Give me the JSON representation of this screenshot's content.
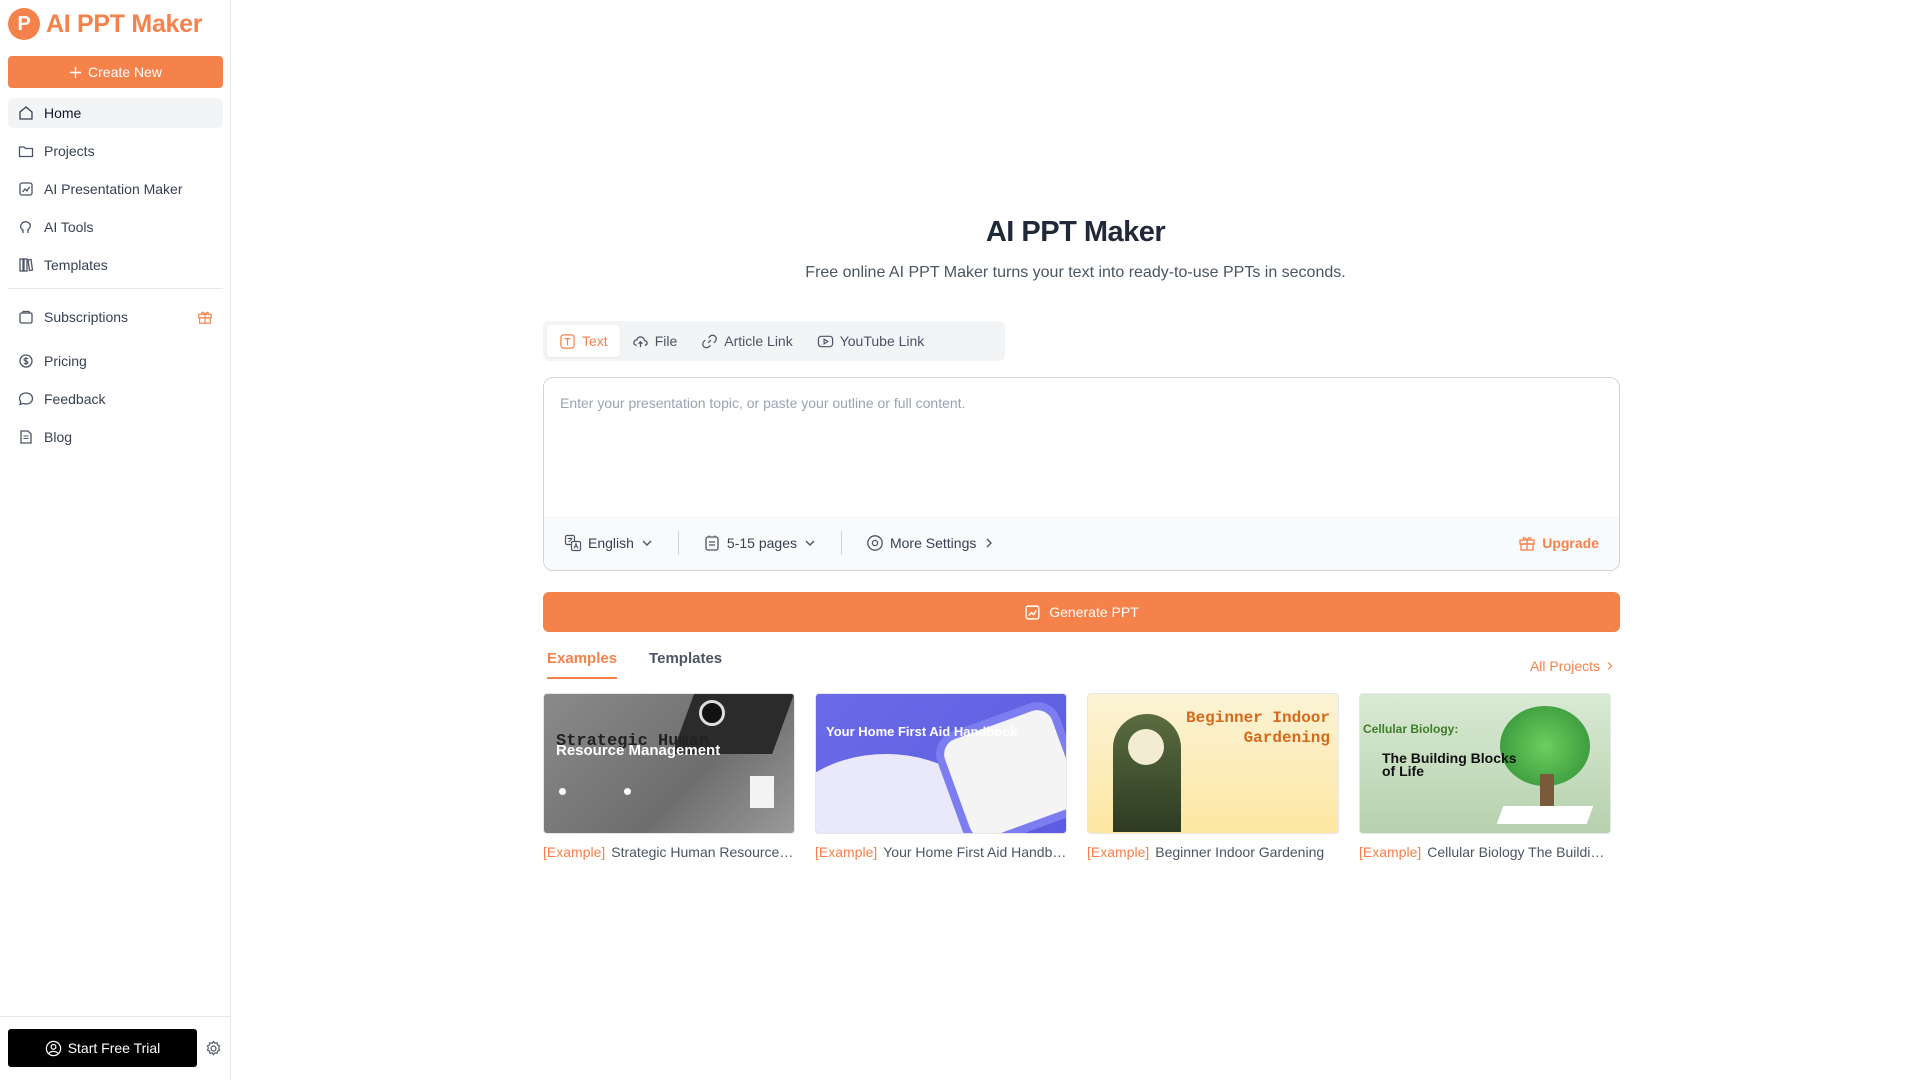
{
  "brand": {
    "logo_letter": "P",
    "name": "AI PPT Maker",
    "accent_color": "#f5824b"
  },
  "sidebar": {
    "create_new": "Create New",
    "nav_primary": [
      {
        "label": "Home",
        "icon": "home-icon",
        "active": true
      },
      {
        "label": "Projects",
        "icon": "folder-icon"
      },
      {
        "label": "AI Presentation Maker",
        "icon": "presentation-icon"
      },
      {
        "label": "AI Tools",
        "icon": "brain-icon"
      },
      {
        "label": "Templates",
        "icon": "books-icon"
      }
    ],
    "nav_secondary": [
      {
        "label": "Subscriptions",
        "icon": "subscription-icon",
        "badge_icon": "gift-icon"
      },
      {
        "label": "Pricing",
        "icon": "dollar-icon"
      },
      {
        "label": "Feedback",
        "icon": "chat-icon"
      },
      {
        "label": "Blog",
        "icon": "document-icon"
      }
    ],
    "start_trial": "Start Free Trial",
    "settings_icon": "gear-icon"
  },
  "main": {
    "title": "AI PPT Maker",
    "subtitle": "Free online AI PPT Maker turns your text into ready-to-use PPTs in seconds.",
    "input_tabs": [
      {
        "label": "Text",
        "icon": "text-icon",
        "active": true
      },
      {
        "label": "File",
        "icon": "cloud-upload-icon"
      },
      {
        "label": "Article Link",
        "icon": "link-icon"
      },
      {
        "label": "YouTube Link",
        "icon": "youtube-icon"
      }
    ],
    "input": {
      "placeholder": "Enter your presentation topic, or paste your outline or full content.",
      "value": ""
    },
    "options": {
      "language": "English",
      "pages": "5-15 pages",
      "more_settings": "More Settings",
      "upgrade": "Upgrade"
    },
    "generate": "Generate PPT",
    "sections": {
      "tabs": [
        {
          "label": "Examples",
          "active": true
        },
        {
          "label": "Templates"
        }
      ],
      "all_projects": "All Projects"
    },
    "examples": [
      {
        "tag": "[Example]",
        "title": "Strategic Human Resource Management",
        "thumb_title_a": "Strategic Human",
        "thumb_title_b": "Resource Management"
      },
      {
        "tag": "[Example]",
        "title": "Your Home First Aid Handbook",
        "thumb_title": "Your Home First Aid Handbook"
      },
      {
        "tag": "[Example]",
        "title": "Beginner Indoor Gardening",
        "thumb_title_a": "Beginner Indoor",
        "thumb_title_b": "Gardening"
      },
      {
        "tag": "[Example]",
        "title": "Cellular Biology The Building Blocks of Life",
        "thumb_title_a": "Cellular Biology:",
        "thumb_title_b": "The Building Blocks",
        "thumb_title_c": "of Life"
      }
    ]
  }
}
